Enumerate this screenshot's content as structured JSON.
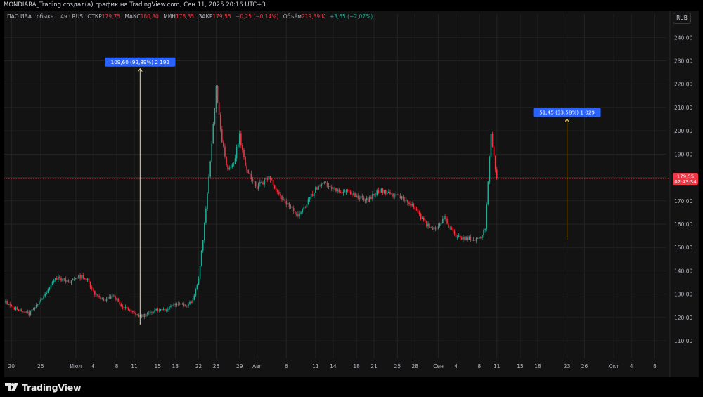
{
  "header": {
    "title": "MONDIARA_Trading создал(а) график на TradingView.com, Сен 11, 2025 20:16 UTC+3"
  },
  "legend": {
    "symbol": "ПАО ИВА · обыкн. · 4ч · RUS",
    "open_label": "ОТКР",
    "open_value": "179,75",
    "high_label": "МАКС",
    "high_value": "180,80",
    "low_label": "МИН",
    "low_value": "178,35",
    "close_label": "ЗАКР",
    "close_value": "179,55",
    "change": "−0,25 (−0,14%)",
    "volume_label": "Объём",
    "volume_value": "219,39 K",
    "volume_change": "+3,65 (+2,07%)"
  },
  "currency": "RUB",
  "footer": {
    "brand": "TradingView"
  },
  "chart_data": {
    "type": "candlestick",
    "ylim": [
      104,
      247
    ],
    "y_ticks": [
      110,
      120,
      130,
      140,
      150,
      160,
      170,
      180,
      190,
      200,
      210,
      220,
      230,
      240
    ],
    "y_tick_labels": [
      "110,00",
      "120,00",
      "130,00",
      "140,00",
      "150,00",
      "160,00",
      "170,00",
      "180,00",
      "190,00",
      "200,00",
      "210,00",
      "220,00",
      "230,00",
      "240,00"
    ],
    "x_start": "2025-06-19",
    "x_end": "2025-10-10",
    "x_ticks": [
      {
        "date": "2025-06-20",
        "label": "20"
      },
      {
        "date": "2025-06-25",
        "label": "25"
      },
      {
        "date": "2025-07-01",
        "label": "Июл"
      },
      {
        "date": "2025-07-04",
        "label": "4"
      },
      {
        "date": "2025-07-08",
        "label": "8"
      },
      {
        "date": "2025-07-11",
        "label": "11"
      },
      {
        "date": "2025-07-15",
        "label": "15"
      },
      {
        "date": "2025-07-18",
        "label": "18"
      },
      {
        "date": "2025-07-22",
        "label": "22"
      },
      {
        "date": "2025-07-25",
        "label": "25"
      },
      {
        "date": "2025-07-29",
        "label": "29"
      },
      {
        "date": "2025-08-01",
        "label": "Авг"
      },
      {
        "date": "2025-08-06",
        "label": "6"
      },
      {
        "date": "2025-08-11",
        "label": "11"
      },
      {
        "date": "2025-08-14",
        "label": "14"
      },
      {
        "date": "2025-08-18",
        "label": "18"
      },
      {
        "date": "2025-08-21",
        "label": "21"
      },
      {
        "date": "2025-08-25",
        "label": "25"
      },
      {
        "date": "2025-08-28",
        "label": "28"
      },
      {
        "date": "2025-09-01",
        "label": "Сен"
      },
      {
        "date": "2025-09-04",
        "label": "4"
      },
      {
        "date": "2025-09-08",
        "label": "8"
      },
      {
        "date": "2025-09-11",
        "label": "11"
      },
      {
        "date": "2025-09-15",
        "label": "15"
      },
      {
        "date": "2025-09-18",
        "label": "18"
      },
      {
        "date": "2025-09-23",
        "label": "23"
      },
      {
        "date": "2025-09-26",
        "label": "26"
      },
      {
        "date": "2025-10-01",
        "label": "Окт"
      },
      {
        "date": "2025-10-04",
        "label": "4"
      },
      {
        "date": "2025-10-08",
        "label": "8"
      }
    ],
    "price_path": [
      [
        "2025-06-19",
        126.5
      ],
      [
        "2025-06-20",
        124.5
      ],
      [
        "2025-06-22",
        123
      ],
      [
        "2025-06-23",
        121.5
      ],
      [
        "2025-06-24",
        124
      ],
      [
        "2025-06-25",
        128
      ],
      [
        "2025-06-26",
        130.5
      ],
      [
        "2025-06-27",
        135
      ],
      [
        "2025-06-28",
        137
      ],
      [
        "2025-06-29",
        136
      ],
      [
        "2025-06-30",
        135
      ],
      [
        "2025-07-01",
        137
      ],
      [
        "2025-07-02",
        137.5
      ],
      [
        "2025-07-03",
        136
      ],
      [
        "2025-07-04",
        131
      ],
      [
        "2025-07-05",
        128.5
      ],
      [
        "2025-07-06",
        127.5
      ],
      [
        "2025-07-07",
        129.5
      ],
      [
        "2025-07-08",
        128
      ],
      [
        "2025-07-09",
        124.5
      ],
      [
        "2025-07-10",
        123
      ],
      [
        "2025-07-11",
        121.5
      ],
      [
        "2025-07-12",
        120.5
      ],
      [
        "2025-07-13",
        121
      ],
      [
        "2025-07-14",
        122.5
      ],
      [
        "2025-07-15",
        123.5
      ],
      [
        "2025-07-16",
        123
      ],
      [
        "2025-07-17",
        124.5
      ],
      [
        "2025-07-18",
        125
      ],
      [
        "2025-07-19",
        125.5
      ],
      [
        "2025-07-20",
        125.5
      ],
      [
        "2025-07-21",
        127
      ],
      [
        "2025-07-22",
        136
      ],
      [
        "2025-07-23",
        160
      ],
      [
        "2025-07-24",
        187
      ],
      [
        "2025-07-25",
        218
      ],
      [
        "2025-07-26",
        196
      ],
      [
        "2025-07-27",
        183
      ],
      [
        "2025-07-28",
        186
      ],
      [
        "2025-07-29",
        198
      ],
      [
        "2025-07-30",
        185
      ],
      [
        "2025-07-31",
        180
      ],
      [
        "2025-08-01",
        176
      ],
      [
        "2025-08-02",
        178
      ],
      [
        "2025-08-03",
        180
      ],
      [
        "2025-08-04",
        176
      ],
      [
        "2025-08-05",
        172
      ],
      [
        "2025-08-06",
        169
      ],
      [
        "2025-08-07",
        167
      ],
      [
        "2025-08-08",
        163
      ],
      [
        "2025-08-09",
        167
      ],
      [
        "2025-08-10",
        171
      ],
      [
        "2025-08-11",
        175
      ],
      [
        "2025-08-12",
        178
      ],
      [
        "2025-08-13",
        177
      ],
      [
        "2025-08-14",
        175
      ],
      [
        "2025-08-15",
        174
      ],
      [
        "2025-08-16",
        174
      ],
      [
        "2025-08-17",
        173
      ],
      [
        "2025-08-18",
        172
      ],
      [
        "2025-08-19",
        171
      ],
      [
        "2025-08-20",
        170
      ],
      [
        "2025-08-21",
        173
      ],
      [
        "2025-08-22",
        174.5
      ],
      [
        "2025-08-23",
        174
      ],
      [
        "2025-08-24",
        173
      ],
      [
        "2025-08-25",
        172
      ],
      [
        "2025-08-26",
        171
      ],
      [
        "2025-08-27",
        169
      ],
      [
        "2025-08-28",
        166
      ],
      [
        "2025-08-29",
        163
      ],
      [
        "2025-08-30",
        160
      ],
      [
        "2025-08-31",
        158
      ],
      [
        "2025-09-01",
        159
      ],
      [
        "2025-09-02",
        163
      ],
      [
        "2025-09-03",
        158
      ],
      [
        "2025-09-04",
        155
      ],
      [
        "2025-09-05",
        154
      ],
      [
        "2025-09-06",
        154
      ],
      [
        "2025-09-07",
        153.5
      ],
      [
        "2025-09-08",
        153.8
      ],
      [
        "2025-09-09",
        158
      ],
      [
        "2025-09-10",
        198
      ],
      [
        "2025-09-11",
        179.55
      ]
    ],
    "last_price": "179,55",
    "countdown": "02:43:34",
    "measurements": [
      {
        "label": "109,60 (92,89%) 2 192",
        "date": "2025-07-12",
        "from": 117,
        "to": 226.6
      },
      {
        "label": "51,45 (33,58%) 1 029",
        "date": "2025-09-23",
        "from": 153.5,
        "to": 205
      }
    ],
    "colors": {
      "up": "#22ab94",
      "down": "#f23645",
      "measure": "#f2d675",
      "badge": "#2962ff",
      "grid": "#232323"
    }
  }
}
